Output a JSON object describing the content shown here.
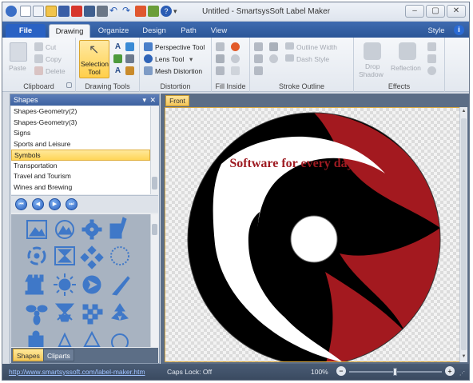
{
  "window": {
    "title": "Untitled - SmartsysSoft Label Maker",
    "controls": [
      "–",
      "▢",
      "✕"
    ]
  },
  "menu": {
    "tabs": [
      "File",
      "Drawing",
      "Organize",
      "Design",
      "Path",
      "View"
    ],
    "active_tab": "Drawing",
    "style_label": "Style",
    "help_label": "i"
  },
  "ribbon": {
    "clipboard": {
      "label": "Clipboard",
      "paste": "Paste",
      "cut": "Cut",
      "copy": "Copy",
      "delete": "Delete"
    },
    "drawing_tools": {
      "label": "Drawing Tools",
      "selection_tool_line1": "Selection",
      "selection_tool_line2": "Tool"
    },
    "distortion": {
      "label": "Distortion",
      "perspective": "Perspective Tool",
      "lens": "Lens Tool",
      "mesh": "Mesh Distortion"
    },
    "fill_inside": {
      "label": "Fill Inside"
    },
    "stroke_outline": {
      "label": "Stroke Outline",
      "outline_width": "Outline Width",
      "dash_style": "Dash Style"
    },
    "effects": {
      "label": "Effects",
      "drop_shadow_line1": "Drop",
      "drop_shadow_line2": "Shadow",
      "reflection": "Reflection"
    }
  },
  "shapes_panel": {
    "title": "Shapes",
    "pin": "▾",
    "close": "✕",
    "items": [
      "Shapes-Geometry(2)",
      "Shapes-Geometry(3)",
      "Signs",
      "Sports and Leisure",
      "Symbols",
      "Transportation",
      "Travel and Tourism",
      "Wines and Brewing"
    ],
    "selected_index": 4,
    "nav_buttons": [
      "first",
      "previous",
      "next",
      "last"
    ],
    "bottom_tabs": [
      "Shapes",
      "Cliparts"
    ],
    "active_bottom_tab": "Shapes"
  },
  "document": {
    "tab": "Front",
    "label_text": "Software for every day",
    "colors": {
      "red": "#a3191f",
      "black": "#000000",
      "white": "#ffffff",
      "text": "#9e1b22"
    }
  },
  "status": {
    "link": "http://www.smartsyssoft.com/label-maker.htm",
    "caps": "Caps Lock: Off",
    "zoom": "100%",
    "zoom_fraction": 0.5
  }
}
